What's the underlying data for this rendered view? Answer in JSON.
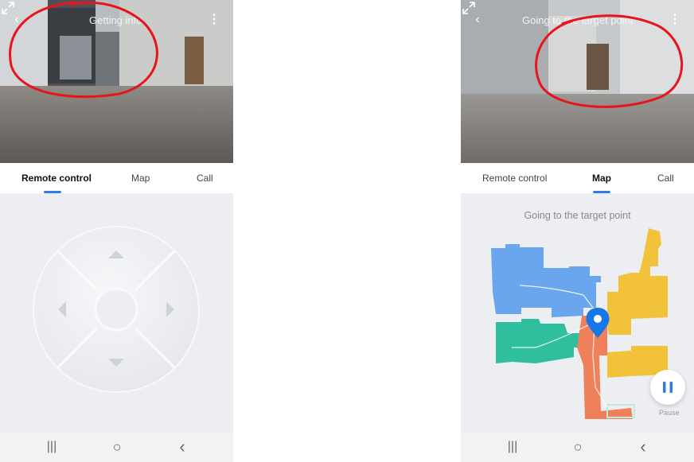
{
  "left_screen": {
    "camera_title": "Getting info",
    "tabs": [
      {
        "label": "Remote control",
        "active": true
      },
      {
        "label": "Map",
        "active": false
      },
      {
        "label": "Call",
        "active": false
      }
    ],
    "icons": {
      "back": "back-chevron-icon",
      "menu": "more-vert-icon",
      "expand": "expand-icon"
    }
  },
  "right_screen": {
    "camera_title": "Going to the target point",
    "status_text": "Going to the target point",
    "pause_label": "Pause",
    "tabs": [
      {
        "label": "Remote control",
        "active": false
      },
      {
        "label": "Map",
        "active": true
      },
      {
        "label": "Call",
        "active": false
      }
    ],
    "map_colors": {
      "blue_room": "#6aa6ee",
      "yellow_room": "#f2c33a",
      "teal_room": "#2fbf9e",
      "orange_room": "#f0805c",
      "robot_pin": "#1677e8"
    }
  },
  "system_nav": {
    "recent": "|||",
    "home": "○",
    "back": "‹"
  },
  "annotations": {
    "color": "#e8141b"
  }
}
